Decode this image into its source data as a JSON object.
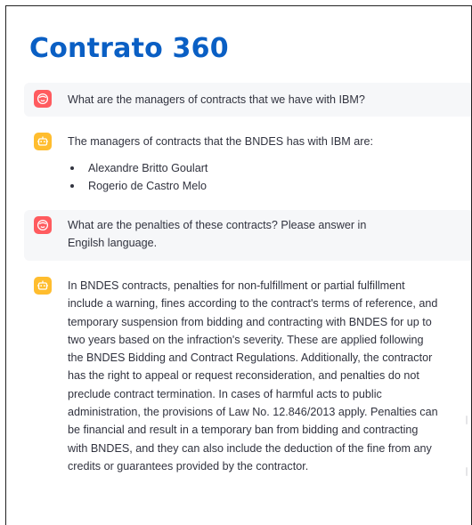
{
  "page": {
    "title": "Contrato 360"
  },
  "messages": [
    {
      "role": "user",
      "avatar_icon": "user-face-icon",
      "text": "What are the managers of contracts that we have with IBM?"
    },
    {
      "role": "assistant",
      "avatar_icon": "robot-icon",
      "intro": "The managers of contracts that the BNDES has with IBM are:",
      "list": [
        "Alexandre Britto Goulart",
        "Rogerio de Castro Melo"
      ]
    },
    {
      "role": "user",
      "avatar_icon": "user-face-icon",
      "text": "What are the penalties of these contracts? Please answer in Engilsh language."
    },
    {
      "role": "assistant",
      "avatar_icon": "robot-icon",
      "text": "In BNDES contracts, penalties for non-fulfillment or partial fulfillment include a warning, fines according to the contract's terms of reference, and temporary suspension from bidding and contracting with BNDES for up to two years based on the infraction's severity. These are applied following the BNDES Bidding and Contract Regulations. Additionally, the contractor has the right to appeal or request reconsideration, and penalties do not preclude contract termination. In cases of harmful acts to public administration, the provisions of Law No. 12.846/2013 apply. Penalties can be financial and result in a temporary ban from bidding and contracting with BNDES, and they can also include the deduction of the fine from any credits or guarantees provided by the contractor."
    }
  ],
  "colors": {
    "title": "#0a5fc4",
    "user_avatar": "#ff5b5f",
    "bot_avatar": "#ffbd2e",
    "user_bubble": "#f6f7f9"
  }
}
